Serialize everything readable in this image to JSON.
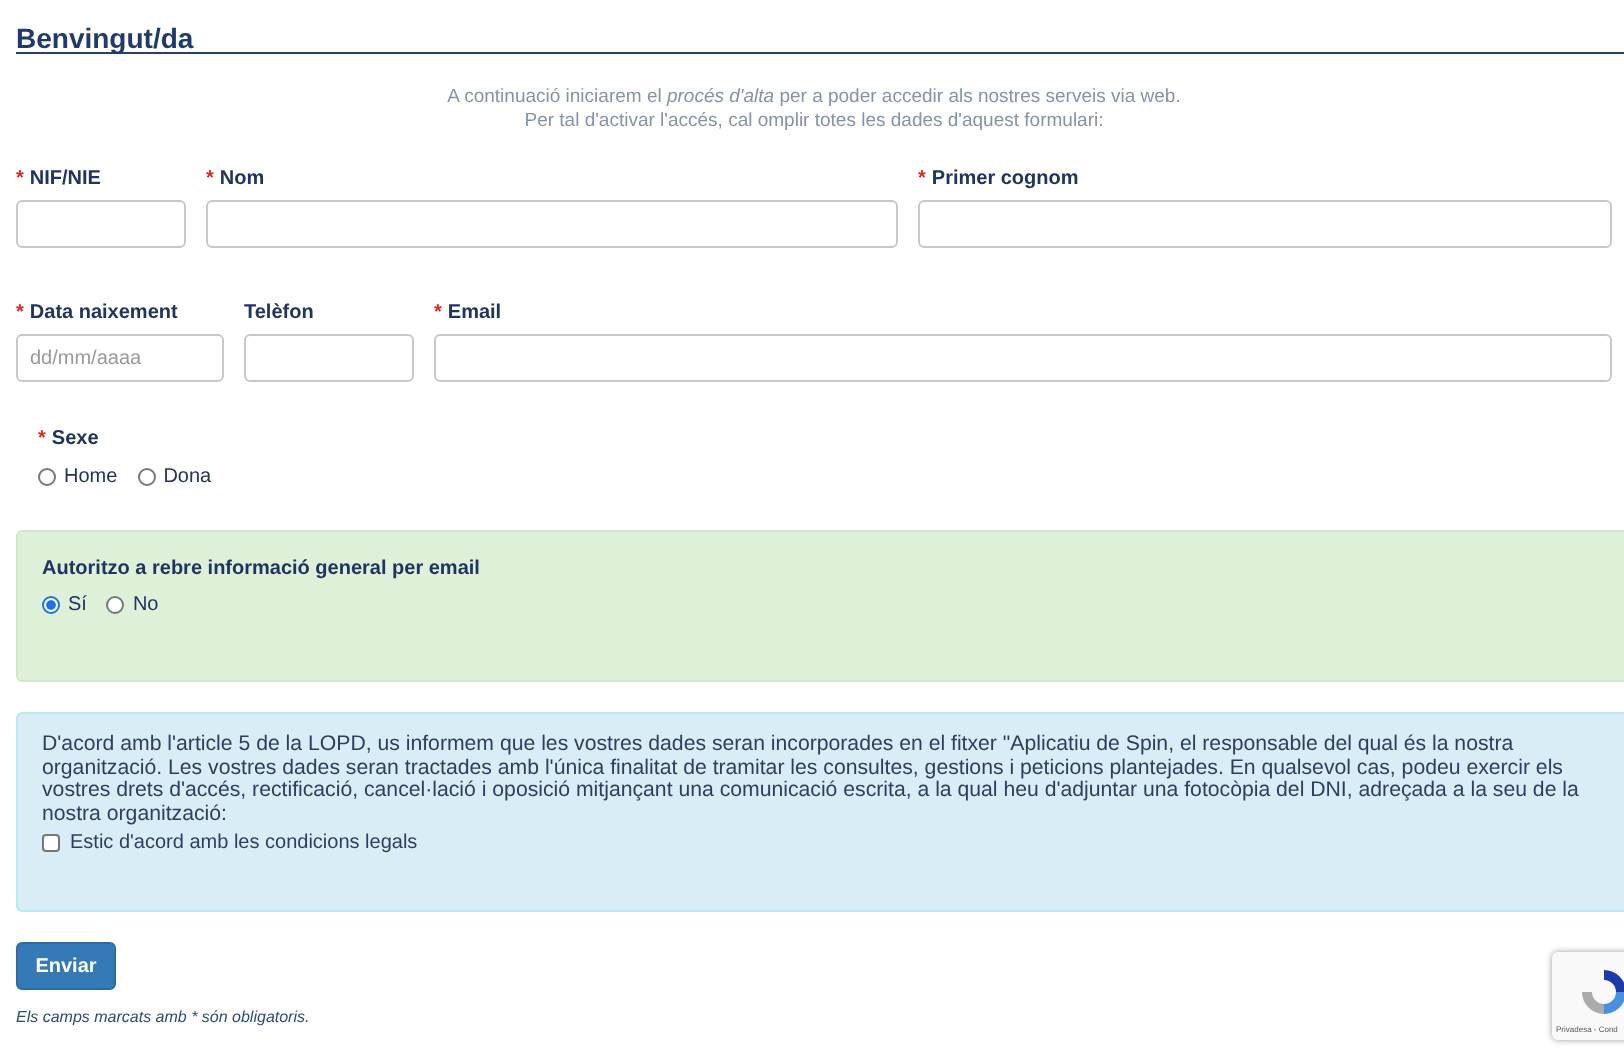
{
  "header": {
    "title": "Benvingut/da"
  },
  "intro": [
    "A continuació iniciarem el *procés d'alta* per a poder accedir als nostres serveis via web.",
    "Per tal d'activar l'accés, cal omplir totes les dades d'aquest formulari:"
  ],
  "field_rows": [
    [
      {
        "label": "NIF/NIE",
        "required_mark": "*"
      },
      {
        "label": "Nom",
        "required_mark": "*"
      },
      {
        "label": "Primer cognom",
        "required_mark": "*"
      }
    ],
    [
      {
        "label": "Data naixement",
        "required_mark": "*",
        "placeholder": "dd/mm/aaaa"
      },
      {
        "label": "Telèfon"
      },
      {
        "label": "Email",
        "required_mark": "*"
      }
    ]
  ],
  "sex": {
    "label": "Sexe",
    "required_mark": "*",
    "options": [
      {
        "label": "Home",
        "selected": false
      },
      {
        "label": "Dona",
        "selected": false
      }
    ]
  },
  "consent_panel": {
    "question": "Autoritzo a rebre informació general per email",
    "options": [
      {
        "label": "Sí",
        "selected": true
      },
      {
        "label": "No",
        "selected": false
      }
    ]
  },
  "legal_panel": {
    "text": "D'acord amb l'article 5 de la LOPD, us informem que les vostres dades seran incorporades en el fitxer \"Aplicatiu de Spin, el responsable del qual és la nostra organització. Les vostres dades seran tractades amb l'única finalitat de tramitar les consultes, gestions i peticions plantejades. En qualsevol cas, podeu exercir els vostres drets d'accés, rectificació, cancel·lació i oposició mitjançant una comunicació escrita, a la qual heu d'adjuntar una fotocòpia del DNI, adreçada a la seu de la nostra organització:",
    "checkbox": {
      "label": "Estic d'acord amb les condicions legals",
      "checked": false
    }
  },
  "submit_button": "Enviar",
  "footnote": "Els camps marcats amb * són obligatoris.",
  "recaptcha": {
    "caption": "Privadesa - Cond"
  }
}
